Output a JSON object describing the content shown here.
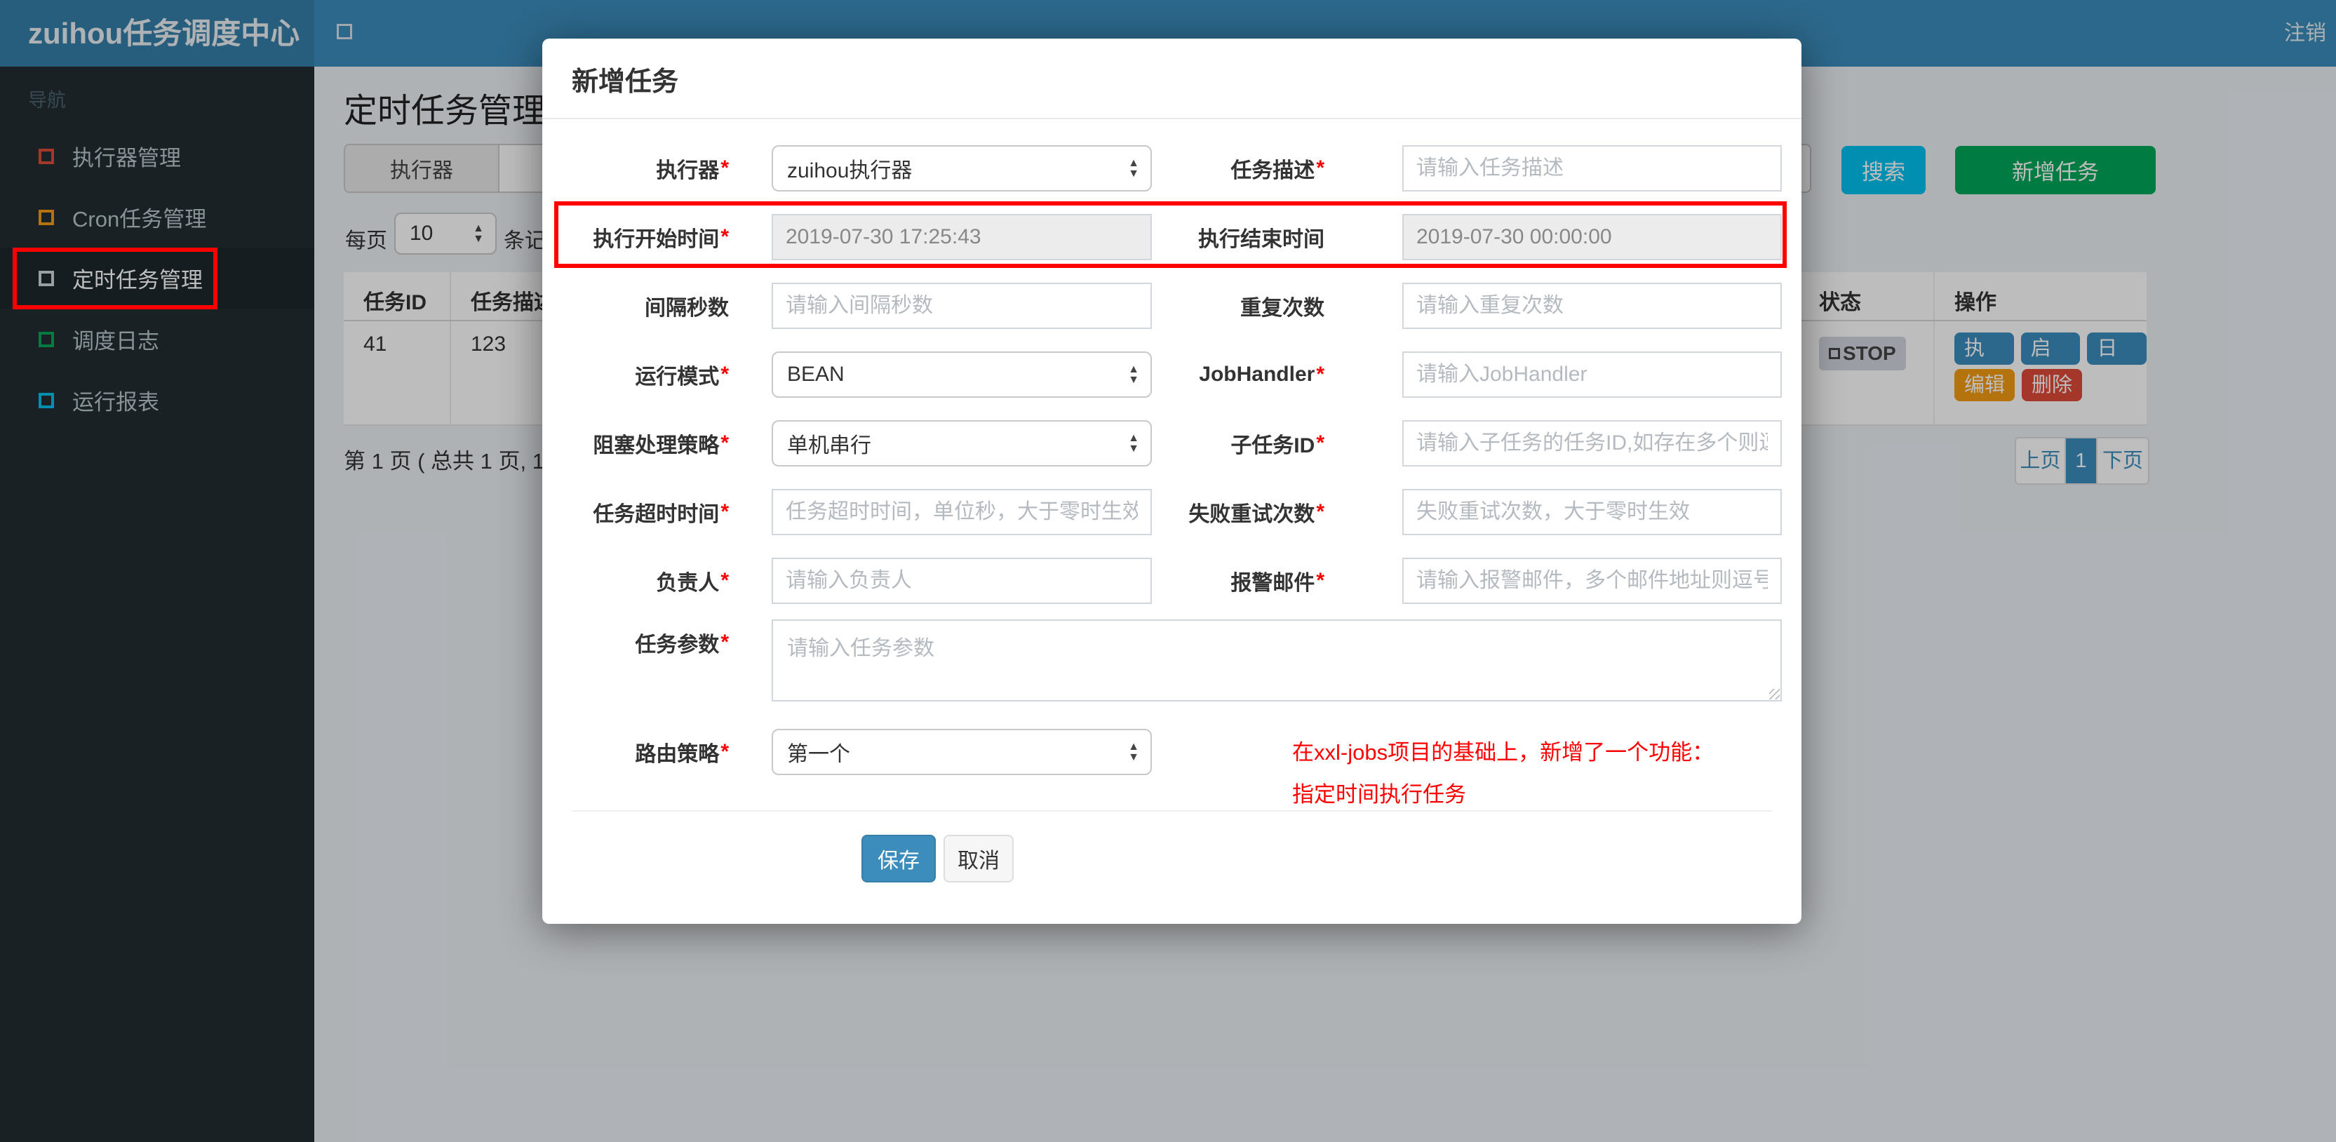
{
  "colors": {
    "primary": "#3c8dbc",
    "info": "#00c0ef",
    "success": "#00a65a",
    "warning": "#f39c12",
    "danger": "#dd4b39",
    "annotation": "#ff0000"
  },
  "navbar": {
    "brand": "zuihou任务调度中心",
    "logout_label": "注销"
  },
  "sidebar": {
    "section_label": "导航",
    "items": [
      {
        "name": "executor-manage",
        "label": "执行器管理",
        "icon_color": "#dd4b39",
        "active": false
      },
      {
        "name": "cron-job-manage",
        "label": "Cron任务管理",
        "icon_color": "#f39c12",
        "active": false
      },
      {
        "name": "timed-job-manage",
        "label": "定时任务管理",
        "icon_color": "#d2d6de",
        "active": true
      },
      {
        "name": "schedule-log",
        "label": "调度日志",
        "icon_color": "#00a65a",
        "active": false
      },
      {
        "name": "run-report",
        "label": "运行报表",
        "icon_color": "#00c0ef",
        "active": false
      }
    ]
  },
  "page": {
    "title": "定时任务管理",
    "filter_addon": "执行器",
    "search_button": "搜索",
    "add_button": "新增任务",
    "per_page": {
      "prefix": "每页",
      "value": "10",
      "suffix": "条记"
    },
    "table": {
      "headers": [
        "任务ID",
        "任务描述",
        "状态",
        "操作"
      ],
      "row": {
        "job_id": "41",
        "job_desc": "123",
        "status_label": "STOP",
        "actions": [
          {
            "name": "run",
            "label": "执行",
            "color": "#3c8dbc"
          },
          {
            "name": "start",
            "label": "启动",
            "color": "#3c8dbc"
          },
          {
            "name": "log",
            "label": "日志",
            "color": "#3c8dbc"
          },
          {
            "name": "edit",
            "label": "编辑",
            "color": "#f39c12"
          },
          {
            "name": "delete",
            "label": "删除",
            "color": "#dd4b39"
          }
        ]
      }
    },
    "pagination": {
      "summary": "第 1 页 ( 总共 1 页, 1",
      "prev": "上页",
      "current": "1",
      "next": "下页"
    }
  },
  "modal": {
    "title": "新增任务",
    "fields": [
      {
        "name": "executor",
        "label": "执行器",
        "required": true,
        "type": "select",
        "value": "zuihou执行器"
      },
      {
        "name": "job-desc",
        "label": "任务描述",
        "required": true,
        "type": "input",
        "placeholder": "请输入任务描述"
      },
      {
        "name": "start-time",
        "label": "执行开始时间",
        "required": true,
        "type": "readonly",
        "value": "2019-07-30 17:25:43"
      },
      {
        "name": "end-time",
        "label": "执行结束时间",
        "required": false,
        "type": "readonly",
        "value": "2019-07-30 00:00:00"
      },
      {
        "name": "interval-seconds",
        "label": "间隔秒数",
        "required": false,
        "type": "input",
        "placeholder": "请输入间隔秒数"
      },
      {
        "name": "repeat-count",
        "label": "重复次数",
        "required": false,
        "type": "input",
        "placeholder": "请输入重复次数"
      },
      {
        "name": "run-mode",
        "label": "运行模式",
        "required": true,
        "type": "select",
        "value": "BEAN"
      },
      {
        "name": "job-handler",
        "label": "JobHandler",
        "required": true,
        "type": "input",
        "placeholder": "请输入JobHandler"
      },
      {
        "name": "block-strategy",
        "label": "阻塞处理策略",
        "required": true,
        "type": "select",
        "value": "单机串行"
      },
      {
        "name": "child-job-id",
        "label": "子任务ID",
        "required": true,
        "type": "input",
        "placeholder": "请输入子任务的任务ID,如存在多个则逗"
      },
      {
        "name": "job-timeout",
        "label": "任务超时时间",
        "required": true,
        "type": "input",
        "placeholder": "任务超时时间，单位秒，大于零时生效"
      },
      {
        "name": "fail-retry-count",
        "label": "失败重试次数",
        "required": true,
        "type": "input",
        "placeholder": "失败重试次数，大于零时生效"
      },
      {
        "name": "owner",
        "label": "负责人",
        "required": true,
        "type": "input",
        "placeholder": "请输入负责人"
      },
      {
        "name": "alarm-email",
        "label": "报警邮件",
        "required": true,
        "type": "input",
        "placeholder": "请输入报警邮件，多个邮件地址则逗号分"
      }
    ],
    "param_field": {
      "name": "job-param",
      "label": "任务参数",
      "required": true,
      "placeholder": "请输入任务参数"
    },
    "route_field": {
      "name": "route-strategy",
      "label": "路由策略",
      "required": true,
      "type": "select",
      "value": "第一个"
    },
    "note_lines": [
      "在xxl-jobs项目的基础上，新增了一个功能：",
      "指定时间执行任务"
    ],
    "save_button": "保存",
    "cancel_button": "取消"
  }
}
